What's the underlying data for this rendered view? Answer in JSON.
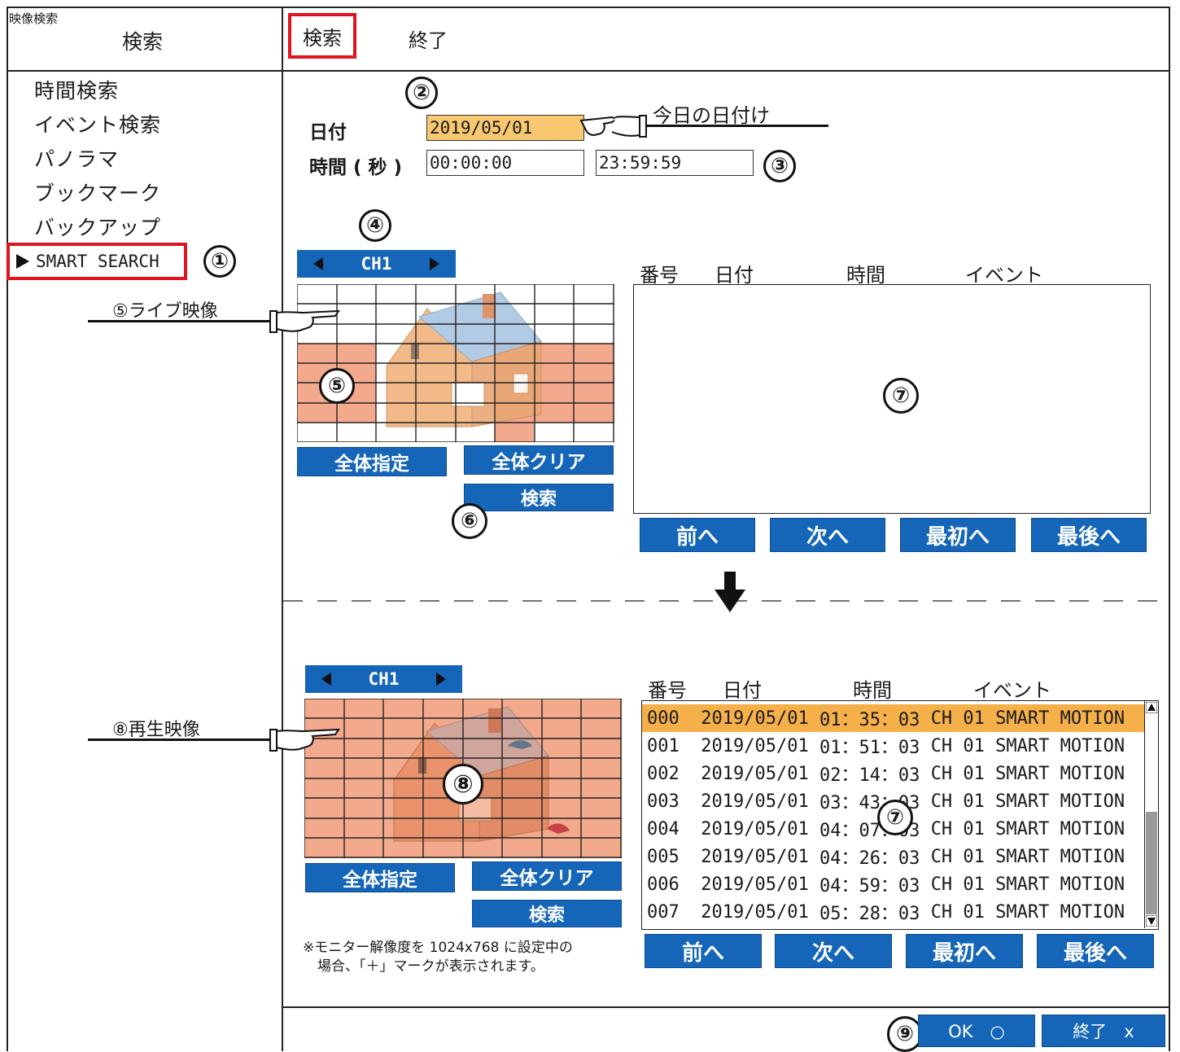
{
  "window": {
    "title": "映像検索",
    "header_left": "検索"
  },
  "toolbar": {
    "search_tab": "検索",
    "exit_tab": "終了"
  },
  "sidebar": {
    "items": [
      {
        "label": "時間検索"
      },
      {
        "label": "イベント検索"
      },
      {
        "label": "パノラマ"
      },
      {
        "label": "ブックマーク"
      },
      {
        "label": "バックアップ"
      },
      {
        "label": "SMART SEARCH",
        "selected": true
      }
    ]
  },
  "annotations": {
    "n1": "①",
    "n2": "②",
    "n3": "③",
    "n4": "④",
    "n5": "⑤",
    "n6": "⑥",
    "n7a": "⑦",
    "n7b": "⑦",
    "n8": "⑧",
    "n9": "⑨",
    "today_date": "今日の日付け",
    "live_video": "⑤ライブ映像",
    "playback_video": "⑧再生映像",
    "note_line1": "※モニター解像度を 1024x768 に設定中の",
    "note_line2": "場合、「＋」マークが表示されます。"
  },
  "form": {
    "date_label": "日付",
    "date_value": "2019/05/01",
    "time_label": "時間 ( 秒 )",
    "time_start": "00:00:00",
    "time_end": "23:59:59"
  },
  "live": {
    "channel": "CH1",
    "select_all": "全体指定",
    "clear_all": "全体クリア",
    "search": "検索"
  },
  "playback": {
    "channel": "CH1",
    "select_all": "全体指定",
    "clear_all": "全体クリア",
    "search": "検索"
  },
  "table_headers": {
    "no": "番号",
    "date": "日付",
    "time": "時間",
    "event": "イベント"
  },
  "events": [
    {
      "no": "000",
      "date": "2019/05/01",
      "time": "01：35：03",
      "ch": "CH 01",
      "event": "SMART MOTION",
      "selected": true
    },
    {
      "no": "001",
      "date": "2019/05/01",
      "time": "01：51：03",
      "ch": "CH 01",
      "event": "SMART MOTION"
    },
    {
      "no": "002",
      "date": "2019/05/01",
      "time": "02：14：03",
      "ch": "CH 01",
      "event": "SMART MOTION"
    },
    {
      "no": "003",
      "date": "2019/05/01",
      "time": "03：43：03",
      "ch": "CH 01",
      "event": "SMART MOTION"
    },
    {
      "no": "004",
      "date": "2019/05/01",
      "time": "04：07：03",
      "ch": "CH 01",
      "event": "SMART MOTION"
    },
    {
      "no": "005",
      "date": "2019/05/01",
      "time": "04：26：03",
      "ch": "CH 01",
      "event": "SMART MOTION"
    },
    {
      "no": "006",
      "date": "2019/05/01",
      "time": "04：59：03",
      "ch": "CH 01",
      "event": "SMART MOTION"
    },
    {
      "no": "007",
      "date": "2019/05/01",
      "time": "05：28：03",
      "ch": "CH 01",
      "event": "SMART MOTION"
    }
  ],
  "paging": {
    "prev": "前へ",
    "next": "次へ",
    "first": "最初へ",
    "last": "最後へ"
  },
  "footer": {
    "ok": "OK　○",
    "exit": "終了　x"
  },
  "colors": {
    "accent_blue": "#1565b8",
    "highlight": "#f6b04a",
    "date_field": "#f8c870",
    "grid_red": "#f3a98b",
    "callout_red": "#e0141e"
  }
}
